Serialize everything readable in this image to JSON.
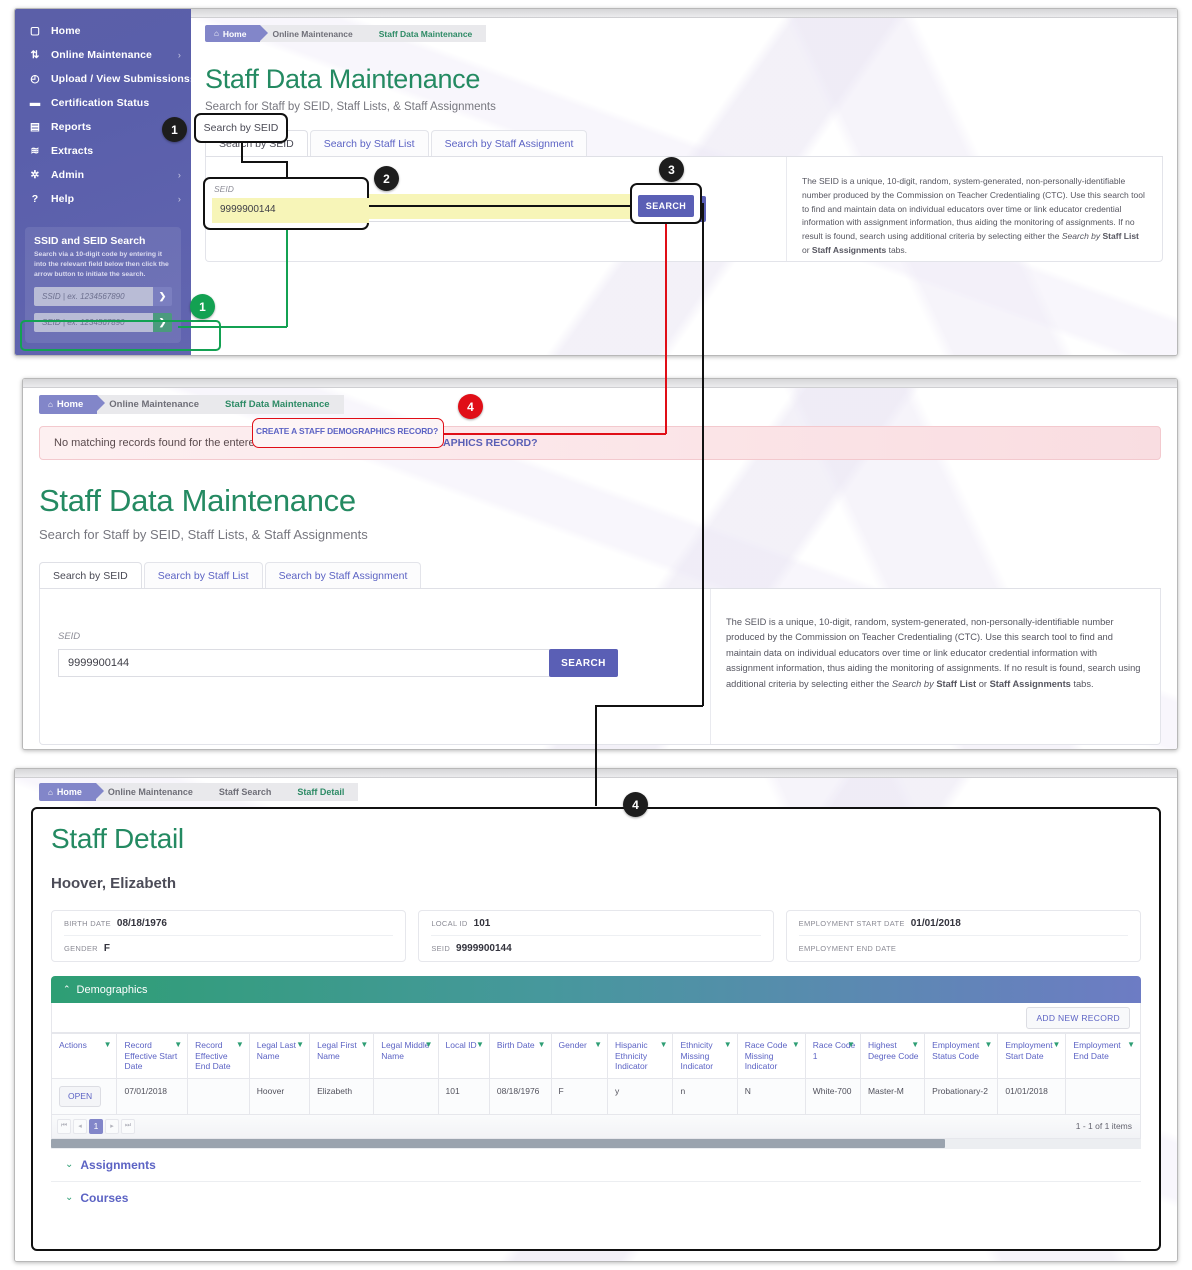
{
  "sidebar": {
    "items": [
      {
        "label": "Home",
        "icon": "home-icon",
        "glyph": "▢",
        "chevron": ""
      },
      {
        "label": "Online Maintenance",
        "icon": "sliders-icon",
        "glyph": "⇅",
        "chevron": "›"
      },
      {
        "label": "Upload / View Submissions",
        "icon": "check-circle-icon",
        "glyph": "◴",
        "chevron": "›"
      },
      {
        "label": "Certification Status",
        "icon": "bar-chart-icon",
        "glyph": "▬",
        "chevron": ""
      },
      {
        "label": "Reports",
        "icon": "document-icon",
        "glyph": "▤",
        "chevron": ""
      },
      {
        "label": "Extracts",
        "icon": "layers-icon",
        "glyph": "≋",
        "chevron": ""
      },
      {
        "label": "Admin",
        "icon": "gear-icon",
        "glyph": "✲",
        "chevron": "›"
      },
      {
        "label": "Help",
        "icon": "question-circle-icon",
        "glyph": "?",
        "chevron": "›"
      }
    ],
    "search_panel": {
      "title": "SSID and SEID Search",
      "description": "Search via a 10-digit code by entering it into the relevant field below then click the arrow button to initiate the search.",
      "ssid_placeholder": "SSID  | ex. 1234567890",
      "seid_placeholder": "SEID  | ex. 1234567890",
      "go_glyph": "❯"
    }
  },
  "panel1": {
    "breadcrumb": [
      {
        "label": "Home",
        "icon": "home-icon",
        "active": false
      },
      {
        "label": "Online Maintenance",
        "active": false
      },
      {
        "label": "Staff Data Maintenance",
        "active": true
      }
    ],
    "title": "Staff Data Maintenance",
    "subtitle": "Search for Staff by SEID, Staff Lists, & Staff Assignments",
    "tabs": [
      {
        "label": "Search by SEID",
        "selected": true
      },
      {
        "label": "Search by Staff List",
        "selected": false
      },
      {
        "label": "Search by Staff Assignment",
        "selected": false
      }
    ],
    "field_label": "SEID",
    "field_value": "9999900144",
    "search_button": "SEARCH",
    "info_text": "The SEID is a unique, 10-digit, random, system-generated, non-personally-identifiable number produced by the Commission on Teacher Credentialing (CTC). Use this search tool to find and maintain data on individual educators over time or link educator credential information with assignment information, thus aiding the monitoring of assignments. If no result is found, search using additional criteria by selecting either the ",
    "info_text_em1": "Search by ",
    "info_text_b1": "Staff List",
    "info_text_mid": " or ",
    "info_text_b2": "Staff Assignments",
    "info_text_end": " tabs."
  },
  "panel2": {
    "breadcrumb": [
      {
        "label": "Home",
        "icon": "home-icon",
        "active": false
      },
      {
        "label": "Online Maintenance",
        "active": false
      },
      {
        "label": "Staff Data Maintenance",
        "active": true
      }
    ],
    "alert_text": "No matching records found for the entered criteria.",
    "alert_link": "CREATE A STAFF DEMOGRAPHICS RECORD?",
    "title": "Staff Data Maintenance",
    "subtitle": "Search for Staff by SEID, Staff Lists, & Staff Assignments",
    "tabs": [
      {
        "label": "Search by SEID",
        "selected": true
      },
      {
        "label": "Search by Staff List",
        "selected": false
      },
      {
        "label": "Search by Staff Assignment",
        "selected": false
      }
    ],
    "field_label": "SEID",
    "field_value": "9999900144",
    "search_button": "SEARCH",
    "info_text": "The SEID is a unique, 10-digit, random, system-generated, non-personally-identifiable number produced by the Commission on Teacher Credentialing (CTC). Use this search tool to find and maintain data on individual educators over time or link educator credential information with assignment information, thus aiding the monitoring of assignments. If no result is found, search using additional criteria by selecting either the ",
    "info_text_em1": "Search by ",
    "info_text_b1": "Staff List",
    "info_text_mid": " or ",
    "info_text_b2": "Staff Assignments",
    "info_text_end": " tabs."
  },
  "panel3": {
    "breadcrumb": [
      {
        "label": "Home",
        "icon": "home-icon",
        "active": false
      },
      {
        "label": "Online Maintenance",
        "active": false
      },
      {
        "label": "Staff Search",
        "active": false
      },
      {
        "label": "Staff Detail",
        "active": true
      }
    ],
    "title": "Staff Detail",
    "person_name": "Hoover, Elizabeth",
    "info_groups": [
      [
        {
          "label": "BIRTH DATE",
          "value": "08/18/1976"
        },
        {
          "label": "GENDER",
          "value": "F"
        }
      ],
      [
        {
          "label": "LOCAL ID",
          "value": "101"
        },
        {
          "label": "SEID",
          "value": "9999900144"
        }
      ],
      [
        {
          "label": "EMPLOYMENT START DATE",
          "value": "01/01/2018"
        },
        {
          "label": "EMPLOYMENT END DATE",
          "value": ""
        }
      ]
    ],
    "section_title": "Demographics",
    "add_record_button": "ADD NEW RECORD",
    "table": {
      "columns": [
        "Actions",
        "Record Effective Start Date",
        "Record Effective End Date",
        "Legal Last Name",
        "Legal First Name",
        "Legal Middle Name",
        "Local ID",
        "Birth Date",
        "Gender",
        "Hispanic Ethnicity Indicator",
        "Ethnicity Missing Indicator",
        "Race Code Missing Indicator",
        "Race Code 1",
        "Highest Degree Code",
        "Employment Status Code",
        "Employment Start Date",
        "Employment End Date"
      ],
      "rows": [
        {
          "action": "OPEN",
          "cells": [
            "07/01/2018",
            "",
            "Hoover",
            "Elizabeth",
            "",
            "101",
            "08/18/1976",
            "F",
            "y",
            "n",
            "N",
            "White-700",
            "Master-M",
            "Probationary-2",
            "01/01/2018",
            ""
          ]
        }
      ]
    },
    "pager": {
      "first": "⏮",
      "prev": "◂",
      "current": "1",
      "next": "▸",
      "last": "⏭",
      "count": "1 - 1 of 1 items"
    },
    "accordions": [
      {
        "label": "Assignments",
        "caret": "⌄"
      },
      {
        "label": "Courses",
        "caret": "⌄"
      }
    ]
  },
  "callouts": [
    {
      "number": "1",
      "color": "#1d1d1d"
    },
    {
      "number": "2",
      "color": "#1d1d1d"
    },
    {
      "number": "3",
      "color": "#1d1d1d"
    },
    {
      "number": "4",
      "color": "#e00e17"
    },
    {
      "number": "1",
      "color": "#13a152"
    },
    {
      "number": "4",
      "color": "#1d1d1d"
    }
  ],
  "colors": {
    "brand_purple": "#5a5fb5",
    "brand_green": "#248a62",
    "accent_link": "#5c63c4",
    "alert_red": "#e00e17",
    "callout_green": "#13a152",
    "highlight_yellow": "#f7f5b8"
  }
}
